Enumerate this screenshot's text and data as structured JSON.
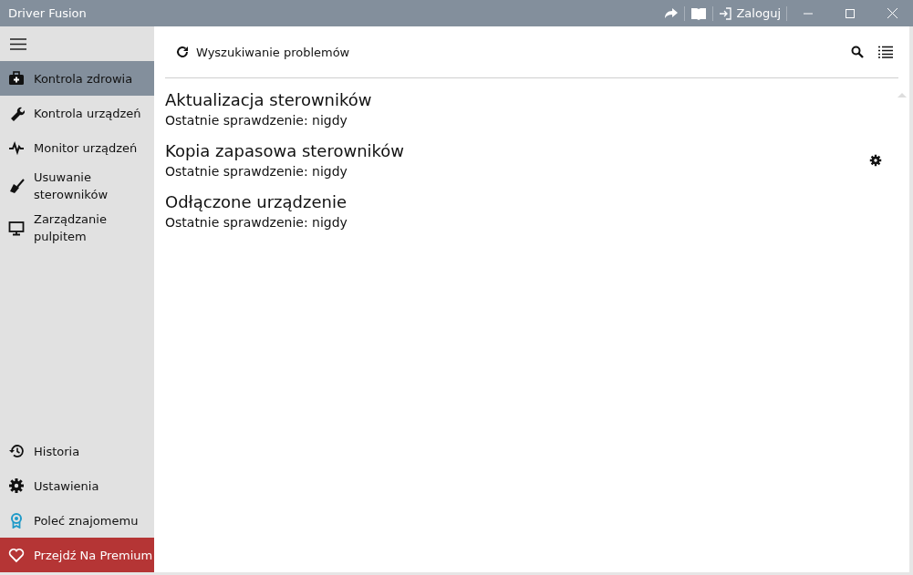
{
  "window": {
    "title": "Driver Fusion"
  },
  "titlebar": {
    "login": "Zaloguj"
  },
  "sidebar": {
    "items": [
      {
        "label": "Kontrola zdrowia",
        "selected": true
      },
      {
        "label": "Kontrola urządzeń",
        "selected": false
      },
      {
        "label": "Monitor urządzeń",
        "selected": false
      },
      {
        "label": "Usuwanie sterowników",
        "selected": false
      },
      {
        "label": "Zarządzanie pulpitem",
        "selected": false
      }
    ],
    "bottom_items": [
      {
        "label": "Historia"
      },
      {
        "label": "Ustawienia"
      },
      {
        "label": "Poleć znajomemu"
      }
    ],
    "premium": "Przejdź Na Premium"
  },
  "toolbar": {
    "scan": "Wyszukiwanie problemów"
  },
  "checks": [
    {
      "title": "Aktualizacja sterowników",
      "status": "Ostatnie sprawdzenie: nigdy",
      "settings_button": false
    },
    {
      "title": "Kopia zapasowa sterowników",
      "status": "Ostatnie sprawdzenie: nigdy",
      "settings_button": true
    },
    {
      "title": "Odłączone urządzenie",
      "status": "Ostatnie sprawdzenie: nigdy",
      "settings_button": false
    }
  ]
}
